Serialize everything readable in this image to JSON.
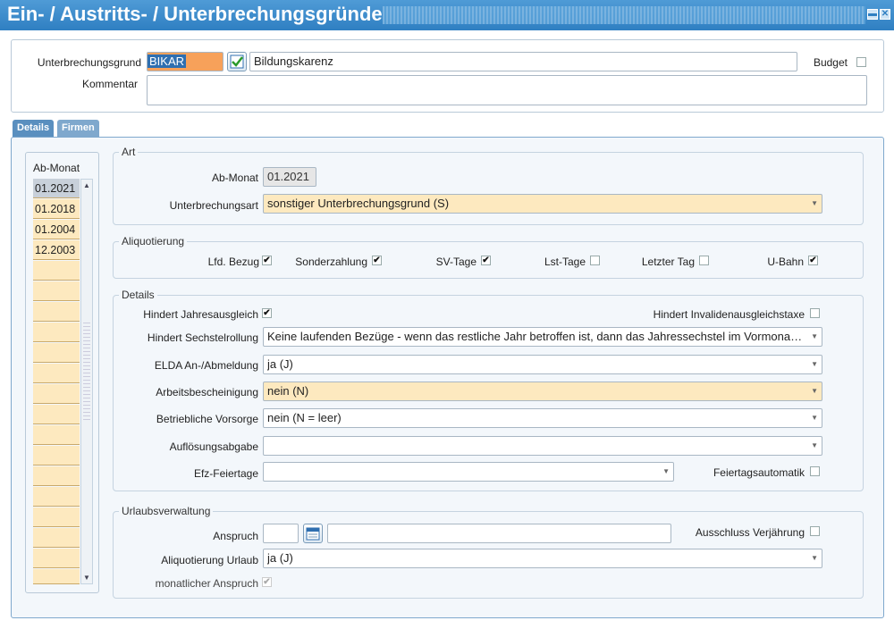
{
  "window": {
    "title": "Ein- / Austritts- / Unterbrechungsgründe",
    "btn_min": "▬",
    "btn_close": "✕"
  },
  "header": {
    "grund_label": "Unterbrechungsgrund",
    "grund_code": "BIKAR",
    "grund_text": "Bildungskarenz",
    "budget_label": "Budget",
    "kommentar_label": "Kommentar",
    "kommentar_value": ""
  },
  "tabs": [
    {
      "label": "Details"
    },
    {
      "label": "Firmen"
    }
  ],
  "list": {
    "header": "Ab-Monat",
    "items": [
      "01.2021",
      "01.2018",
      "01.2004",
      "12.2003"
    ]
  },
  "art": {
    "title": "Art",
    "abmonat_label": "Ab-Monat",
    "abmonat_value": "01.2021",
    "uart_label": "Unterbrechungsart",
    "uart_value": "sonstiger Unterbrechungsgrund (S)"
  },
  "aliquot": {
    "title": "Aliquotierung",
    "items": [
      {
        "label": "Lfd. Bezug",
        "checked": true
      },
      {
        "label": "Sonderzahlung",
        "checked": true
      },
      {
        "label": "SV-Tage",
        "checked": true
      },
      {
        "label": "Lst-Tage",
        "checked": false
      },
      {
        "label": "Letzter Tag",
        "checked": false
      },
      {
        "label": "U-Bahn",
        "checked": true
      }
    ]
  },
  "details": {
    "title": "Details",
    "jahresausgleich_label": "Hindert Jahresausgleich",
    "invaliden_label": "Hindert Invalidenausgleichstaxe",
    "sechstel_label": "Hindert Sechstelrollung",
    "sechstel_value": "Keine laufenden Bezüge - wenn das restliche Jahr betroffen ist, dann das Jahressechstel im Vormonat k...",
    "elda_label": "ELDA An-/Abmeldung",
    "elda_value": "ja (J)",
    "arbeits_label": "Arbeitsbescheinigung",
    "arbeits_value": "nein (N)",
    "vorsorge_label": "Betriebliche Vorsorge",
    "vorsorge_value": "nein (N = leer)",
    "abgabe_label": "Auflösungsabgabe",
    "abgabe_value": "",
    "efz_label": "Efz-Feiertage",
    "efz_value": "",
    "feiertag_label": "Feiertagsautomatik"
  },
  "urlaub": {
    "title": "Urlaubsverwaltung",
    "anspruch_label": "Anspruch",
    "ausschluss_label": "Ausschluss Verjährung",
    "aliq_label": "Aliquotierung Urlaub",
    "aliq_value": "ja (J)",
    "monatlich_label": "monatlicher Anspruch"
  },
  "colors": {
    "title_bar": "#2f7fc2",
    "highlight": "#f7a15a",
    "mandatory": "#fde9bf",
    "tab": "#5a8fbf"
  }
}
